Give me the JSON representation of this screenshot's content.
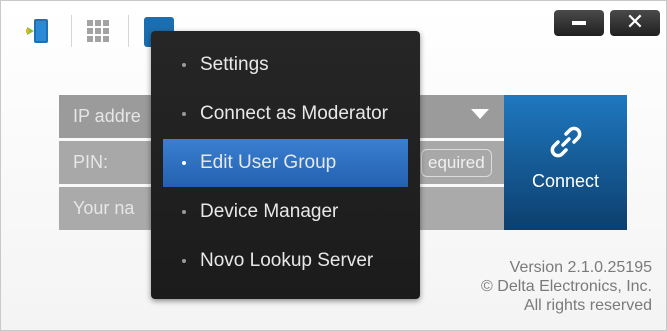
{
  "toolbar": {
    "icons": [
      "present-icon",
      "grid-icon",
      "menu-toggle-icon"
    ]
  },
  "window_controls": {
    "minimize_symbol": "−",
    "close_symbol": "✕"
  },
  "form": {
    "ip_placeholder": "IP addre",
    "pin_placeholder": "PIN:",
    "pin_badge": "equired",
    "name_placeholder": "Your na",
    "connect_label": "Connect"
  },
  "menu": {
    "items": [
      {
        "label": "Settings",
        "active": false
      },
      {
        "label": "Connect as Moderator",
        "active": false
      },
      {
        "label": "Edit User Group",
        "active": true
      },
      {
        "label": "Device Manager",
        "active": false
      },
      {
        "label": "Novo Lookup Server",
        "active": false
      }
    ]
  },
  "version": {
    "line1": "Version 2.1.0.25195",
    "line2": "© Delta Electronics, Inc.",
    "line3": "All rights reserved"
  },
  "colors": {
    "accent": "#1b6fb0",
    "menu_bg": "#222222",
    "menu_active": "#2f70c0",
    "field_bg": "#a8a8a8"
  }
}
